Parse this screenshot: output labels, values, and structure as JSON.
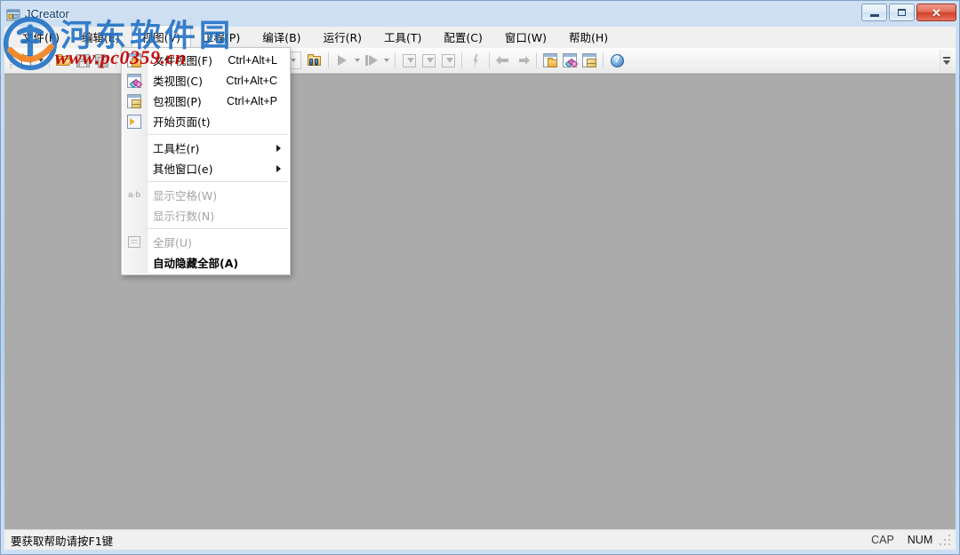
{
  "window": {
    "title": "JCreator",
    "icon": "jcreator-app-icon",
    "buttons": {
      "minimize": "minimize-button",
      "maximize": "maximize-button",
      "close": "✕"
    }
  },
  "menubar": {
    "items": [
      {
        "label": "文件(F)",
        "name": "menu-file",
        "open": false
      },
      {
        "label": "编辑(E)",
        "name": "menu-edit",
        "open": false
      },
      {
        "label": "视图(V)",
        "name": "menu-view",
        "open": true
      },
      {
        "label": "工程(P)",
        "name": "menu-project",
        "open": false
      },
      {
        "label": "编译(B)",
        "name": "menu-build",
        "open": false
      },
      {
        "label": "运行(R)",
        "name": "menu-run",
        "open": false
      },
      {
        "label": "工具(T)",
        "name": "menu-tools",
        "open": false
      },
      {
        "label": "配置(C)",
        "name": "menu-configure",
        "open": false
      },
      {
        "label": "窗口(W)",
        "name": "menu-window",
        "open": false
      },
      {
        "label": "帮助(H)",
        "name": "menu-help",
        "open": false
      }
    ]
  },
  "view_menu": {
    "items": [
      {
        "label": "文件视图(F)",
        "accel": "Ctrl+Alt+L",
        "icon": "file-view-icon",
        "disabled": false,
        "submenu": false,
        "bold": false
      },
      {
        "label": "类视图(C)",
        "accel": "Ctrl+Alt+C",
        "icon": "class-view-icon",
        "disabled": false,
        "submenu": false,
        "bold": false
      },
      {
        "label": "包视图(P)",
        "accel": "Ctrl+Alt+P",
        "icon": "package-view-icon",
        "disabled": false,
        "submenu": false,
        "bold": false
      },
      {
        "label": "开始页面(t)",
        "accel": "",
        "icon": "start-page-icon",
        "disabled": false,
        "submenu": false,
        "bold": false
      },
      {
        "separator": true
      },
      {
        "label": "工具栏(r)",
        "accel": "",
        "icon": "",
        "disabled": false,
        "submenu": true,
        "bold": false
      },
      {
        "label": "其他窗口(e)",
        "accel": "",
        "icon": "",
        "disabled": false,
        "submenu": true,
        "bold": false
      },
      {
        "separator": true
      },
      {
        "label": "显示空格(W)",
        "accel": "",
        "icon": "show-whitespace-icon",
        "disabled": true,
        "submenu": false,
        "bold": false
      },
      {
        "label": "显示行数(N)",
        "accel": "",
        "icon": "",
        "disabled": true,
        "submenu": false,
        "bold": false
      },
      {
        "separator": true
      },
      {
        "label": "全屏(U)",
        "accel": "",
        "icon": "fullscreen-icon",
        "disabled": true,
        "submenu": false,
        "bold": false
      },
      {
        "label": "自动隐藏全部(A)",
        "accel": "",
        "icon": "",
        "disabled": false,
        "submenu": false,
        "bold": true
      }
    ]
  },
  "toolbar": {
    "combo_value": "",
    "buttons": [
      {
        "name": "new-file-button",
        "icon": "new-document-icon",
        "disabled": false,
        "dropdown": true
      },
      {
        "name": "open-file-button",
        "icon": "open-folder-icon",
        "disabled": false,
        "dropdown": false
      },
      {
        "name": "save-button",
        "icon": "save-icon",
        "disabled": true,
        "dropdown": false
      },
      {
        "name": "save-all-button",
        "icon": "save-all-icon",
        "disabled": true,
        "dropdown": false
      },
      {
        "name": "find-in-files-button",
        "icon": "find-folder-icon",
        "disabled": false,
        "dropdown": false
      },
      {
        "name": "run-project-button",
        "icon": "run-triangle-icon",
        "disabled": true,
        "dropdown": true
      },
      {
        "name": "run-file-button",
        "icon": "run-step-icon",
        "disabled": true,
        "dropdown": true
      },
      {
        "name": "compile-button",
        "icon": "compile-down-icon",
        "disabled": true,
        "dropdown": false
      },
      {
        "name": "compile-project-button",
        "icon": "compile-project-icon",
        "disabled": true,
        "dropdown": false
      },
      {
        "name": "lightning-button",
        "icon": "bolt-icon",
        "disabled": true,
        "dropdown": false
      },
      {
        "name": "nav-back-button",
        "icon": "arrow-left-icon",
        "disabled": true,
        "dropdown": false
      },
      {
        "name": "nav-forward-button",
        "icon": "arrow-right-icon",
        "disabled": true,
        "dropdown": false
      },
      {
        "name": "file-view-toggle-button",
        "icon": "file-view-icon",
        "disabled": false,
        "dropdown": false
      },
      {
        "name": "class-view-toggle-button",
        "icon": "class-view-icon",
        "disabled": false,
        "dropdown": false
      },
      {
        "name": "package-view-toggle-button",
        "icon": "package-view-icon",
        "disabled": false,
        "dropdown": false
      },
      {
        "name": "help-button",
        "icon": "help-icon",
        "disabled": false,
        "dropdown": false
      }
    ],
    "overflow": "toolbar-overflow-chevron"
  },
  "statusbar": {
    "message": "要获取帮助请按F1键",
    "caps": "CAP",
    "num": "NUM"
  },
  "watermark": {
    "site_name": "河东软件园",
    "site_url": "www.pc0359.cn",
    "colors": {
      "site_name": "#1d6fc4",
      "site_url": "#c00000"
    }
  }
}
